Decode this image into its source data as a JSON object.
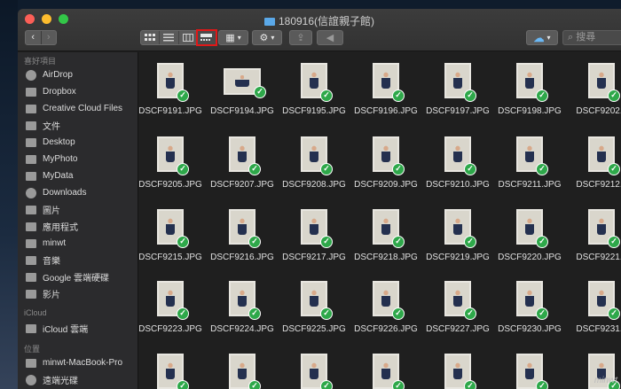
{
  "window": {
    "title": "180916(信誼親子館)"
  },
  "toolbar": {
    "back_icon": "chevron-left-icon",
    "forward_icon": "chevron-right-icon",
    "view_modes": [
      "icon-view",
      "list-view",
      "column-view",
      "cover-flow-view"
    ],
    "active_view": "cover-flow-view",
    "search_placeholder": "搜尋"
  },
  "sidebar": {
    "favorites_header": "喜好項目",
    "favorites": [
      {
        "label": "AirDrop",
        "icon": "airdrop-icon"
      },
      {
        "label": "Dropbox",
        "icon": "folder-icon"
      },
      {
        "label": "Creative Cloud Files",
        "icon": "folder-icon"
      },
      {
        "label": "文件",
        "icon": "document-icon"
      },
      {
        "label": "Desktop",
        "icon": "desktop-icon"
      },
      {
        "label": "MyPhoto",
        "icon": "folder-icon"
      },
      {
        "label": "MyData",
        "icon": "folder-icon"
      },
      {
        "label": "Downloads",
        "icon": "download-icon"
      },
      {
        "label": "圖片",
        "icon": "camera-icon"
      },
      {
        "label": "應用程式",
        "icon": "applications-icon"
      },
      {
        "label": "minwt",
        "icon": "home-icon"
      },
      {
        "label": "音樂",
        "icon": "music-icon"
      },
      {
        "label": "Google 雲端硬碟",
        "icon": "folder-icon"
      },
      {
        "label": "影片",
        "icon": "film-icon"
      }
    ],
    "icloud_header": "iCloud",
    "icloud": [
      {
        "label": "iCloud 雲端",
        "icon": "cloud-icon"
      }
    ],
    "locations_header": "位置",
    "locations": [
      {
        "label": "minwt-MacBook-Pro",
        "icon": "laptop-icon"
      },
      {
        "label": "遠端光碟",
        "icon": "disc-icon"
      }
    ]
  },
  "files": [
    [
      "DSCF9191.JPG",
      "DSCF9194.JPG",
      "DSCF9195.JPG",
      "DSCF9196.JPG",
      "DSCF9197.JPG",
      "DSCF9198.JPG",
      "DSCF9202.J"
    ],
    [
      "DSCF9205.JPG",
      "DSCF9207.JPG",
      "DSCF9208.JPG",
      "DSCF9209.JPG",
      "DSCF9210.JPG",
      "DSCF9211.JPG",
      "DSCF9212.J"
    ],
    [
      "DSCF9215.JPG",
      "DSCF9216.JPG",
      "DSCF9217.JPG",
      "DSCF9218.JPG",
      "DSCF9219.JPG",
      "DSCF9220.JPG",
      "DSCF9221.J"
    ],
    [
      "DSCF9223.JPG",
      "DSCF9224.JPG",
      "DSCF9225.JPG",
      "DSCF9226.JPG",
      "DSCF9227.JPG",
      "DSCF9230.JPG",
      "DSCF9231.J"
    ],
    [
      "",
      "",
      "",
      "",
      "",
      "",
      ""
    ]
  ],
  "sync_status_icon": "checkmark-icon",
  "watermark": "minwt"
}
